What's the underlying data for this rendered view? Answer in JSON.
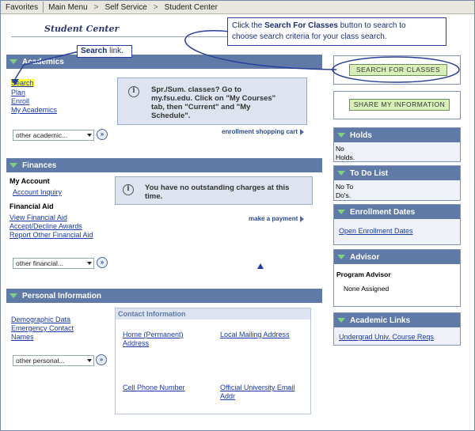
{
  "topbar": {
    "favorites": "Favorites",
    "main_menu": "Main Menu",
    "sep": ">",
    "self_service": "Self Service",
    "student_center": "Student Center"
  },
  "page_title": "Student Center",
  "academics": {
    "header": "Academics",
    "links": [
      "Search",
      "Plan",
      "Enroll",
      "My Academics"
    ],
    "select": "other academic...",
    "info": "Spr./Sum. classes? Go to my.fsu.edu. Click on \"My Courses\" tab, then \"Current\" and \"My Schedule\".",
    "info_lines": [
      "Spr./Sum. classes? Go to",
      "my.fsu.edu. Click on \"My Courses\"",
      "tab, then \"Current\" and \"My",
      "Schedule\"."
    ],
    "cart_link": "enrollment shopping cart"
  },
  "finances": {
    "header": "Finances",
    "my_account": "My Account",
    "account_inquiry": "Account Inquiry",
    "financial_aid": "Financial Aid",
    "aid_links": [
      "View Financial Aid",
      "Accept/Decline Awards",
      "Report Other Financial Aid"
    ],
    "select": "other financial...",
    "info_lines": [
      "You have no outstanding charges at this",
      "time."
    ],
    "make_payment": "make a payment"
  },
  "personal": {
    "header": "Personal Information",
    "links": [
      "Demographic Data",
      "Emergency Contact",
      "Names"
    ],
    "select": "other personal...",
    "contact_header": "Contact Information",
    "home": [
      "Home (Permanent)",
      "Address"
    ],
    "local": "Local Mailing Address",
    "cell": "Cell Phone Number",
    "email": [
      "Official University Email",
      "Addr"
    ]
  },
  "buttons": {
    "search_classes": "Search For Classes",
    "share_info": "Share My Information"
  },
  "panels": {
    "holds": {
      "title": "Holds",
      "body": [
        "No",
        "Holds."
      ]
    },
    "todo": {
      "title": "To Do List",
      "body": [
        "No To",
        "Do's."
      ]
    },
    "enroll_dates": {
      "title": "Enrollment Dates",
      "link": "Open Enrollment Dates"
    },
    "advisor": {
      "title": "Advisor",
      "label": "Program Advisor",
      "value": "None Assigned"
    },
    "links": {
      "title": "Academic Links",
      "link": "Undergrad Univ. Course Reqs"
    }
  },
  "callouts": {
    "search_link": {
      "bold": "Search",
      "rest": " link."
    },
    "search_classes": {
      "pre": "Click the ",
      "bold": "Search For Classes",
      "post": " button to search to choose search criteria for your class search.",
      "line1_post": " button to search to",
      "line2": "choose search criteria for your class search."
    }
  },
  "colors": {
    "header_blue": "#5f7aa6",
    "highlight": "#ffff33",
    "button_green": "#d9efb8",
    "callout_border": "#2a3f9a"
  }
}
